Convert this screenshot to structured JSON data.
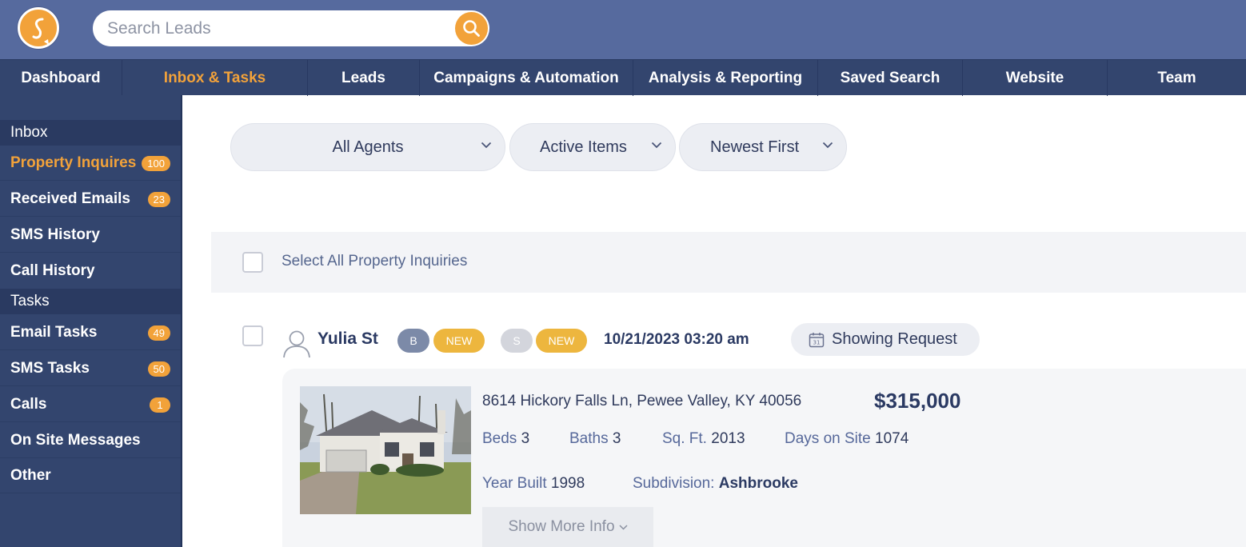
{
  "search": {
    "placeholder": "Search Leads"
  },
  "nav": {
    "items": [
      {
        "label": "Dashboard"
      },
      {
        "label": "Inbox & Tasks"
      },
      {
        "label": "Leads"
      },
      {
        "label": "Campaigns & Automation"
      },
      {
        "label": "Analysis & Reporting"
      },
      {
        "label": "Saved Search"
      },
      {
        "label": "Website"
      },
      {
        "label": "Team"
      }
    ],
    "active": "Inbox & Tasks"
  },
  "sidebar": {
    "inbox_heading": "Inbox",
    "inbox_items": [
      {
        "label": "Property Inquires",
        "count": "100"
      },
      {
        "label": "Received Emails",
        "count": "23"
      },
      {
        "label": "SMS History"
      },
      {
        "label": "Call History"
      }
    ],
    "tasks_heading": "Tasks",
    "task_items": [
      {
        "label": "Email Tasks",
        "count": "49"
      },
      {
        "label": "SMS Tasks",
        "count": "50"
      },
      {
        "label": "Calls",
        "count": "1"
      },
      {
        "label": "On Site Messages"
      },
      {
        "label": "Other"
      }
    ],
    "active": "Property Inquires"
  },
  "filters": {
    "agents": "All Agents",
    "status": "Active Items",
    "sort": "Newest First"
  },
  "select_all_label": "Select All Property Inquiries",
  "lead": {
    "name": "Yulia St",
    "buyer_badge": "B",
    "buyer_status": "NEW",
    "seller_badge": "S",
    "seller_status": "NEW",
    "date": "10/21/2023 03:20 am",
    "action_label": "Showing Request",
    "property": {
      "address": "8614 Hickory Falls Ln, Pewee Valley, KY 40056",
      "price": "$315,000",
      "beds_label": "Beds",
      "beds": "3",
      "baths_label": "Baths",
      "baths": "3",
      "sqft_label": "Sq. Ft.",
      "sqft": "2013",
      "days_label": "Days on Site",
      "days": "1074",
      "year_label": "Year Built",
      "year": "1998",
      "subdivision_label": "Subdivision:",
      "subdivision": "Ashbrooke",
      "more_label": "Show More Info"
    }
  },
  "colors": {
    "accent": "#f2a23a",
    "header": "#566a9e",
    "nav": "#33456e",
    "badge_new": "#edb63e",
    "badge_b": "#7c8aa8",
    "badge_s": "#d3d5dc"
  }
}
